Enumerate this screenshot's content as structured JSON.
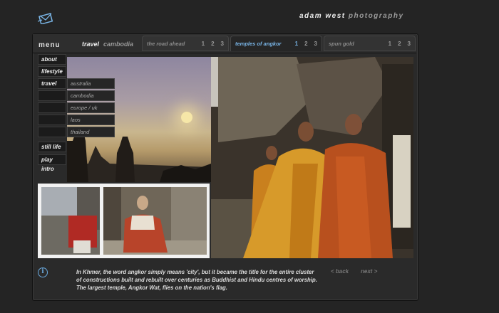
{
  "brand": {
    "name": "adam west",
    "sub": "photography"
  },
  "menu_label": "menu",
  "current_tab": {
    "label": "travel",
    "sub": "cambodia"
  },
  "tabs": [
    {
      "label": "the road ahead",
      "pages": [
        "1",
        "2",
        "3"
      ]
    },
    {
      "label": "temples of angkor",
      "pages": [
        "1",
        "2",
        "3"
      ]
    },
    {
      "label": "spun gold",
      "pages": [
        "1",
        "2",
        "3"
      ]
    }
  ],
  "sidebar": {
    "items": [
      "about",
      "lifestyle",
      "travel",
      "still life",
      "play intro"
    ]
  },
  "travel_submenu": [
    "australia",
    "cambodia",
    "europe / uk",
    "laos",
    "thailand"
  ],
  "caption": "In Khmer, the word angkor simply means 'city', but it became the title for the entire cluster of constructions built and rebuilt over centuries as Buddhist and Hindu centres of worship. The largest temple, Angkor Wat, flies on the nation's flag.",
  "nav": {
    "back": "< back",
    "next": "next >"
  },
  "colors": {
    "accent": "#7ab6e8",
    "background": "#242424"
  },
  "icons": {
    "logo": "envelope-icon",
    "info": "info-icon"
  }
}
